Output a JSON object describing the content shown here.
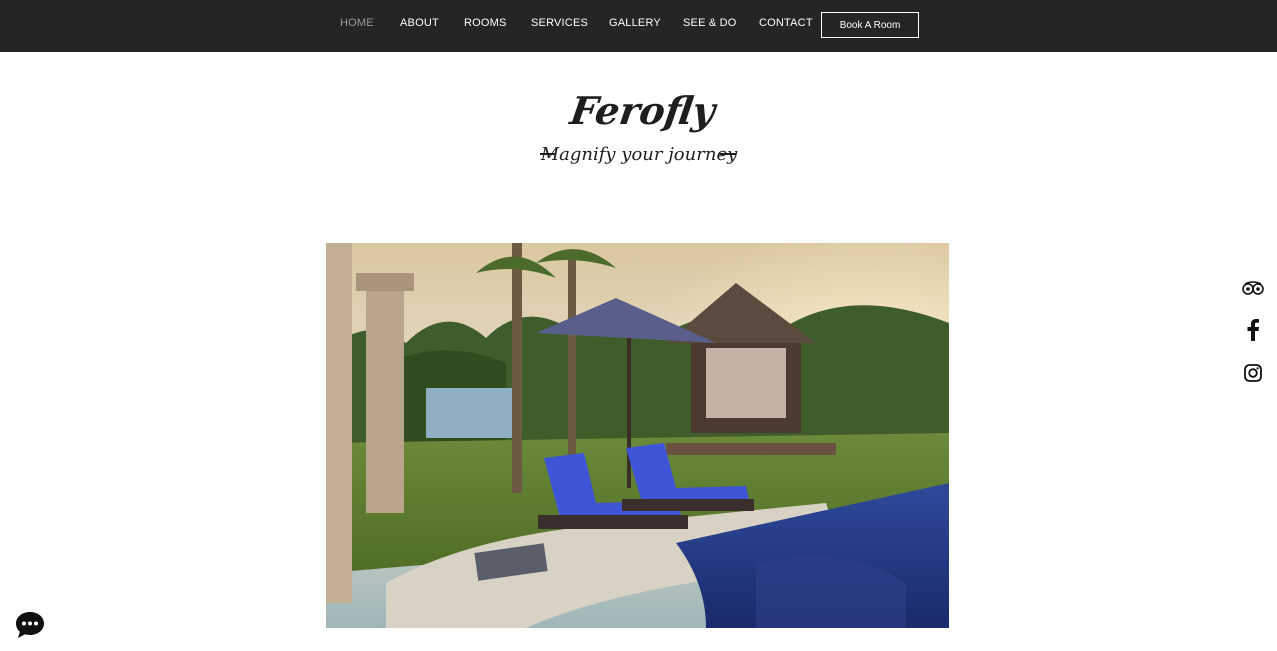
{
  "nav": {
    "items": [
      {
        "label": "HOME",
        "active": true
      },
      {
        "label": "ABOUT"
      },
      {
        "label": "ROOMS"
      },
      {
        "label": "SERVICES"
      },
      {
        "label": "GALLERY"
      },
      {
        "label": "SEE & DO"
      },
      {
        "label": "CONTACT"
      }
    ],
    "book_label": "Book A Room"
  },
  "brand": {
    "name": "Ferofly",
    "tagline": "Magnify your journey"
  },
  "hero": {
    "image": "resort-pool-with-loungers-and-gazebo"
  },
  "social": {
    "icons": [
      "tripadvisor-icon",
      "facebook-icon",
      "instagram-icon"
    ]
  },
  "chat": {
    "icon": "chat-bubble-icon"
  },
  "colors": {
    "topbar": "#252525",
    "nav_text": "#ffffff",
    "nav_active": "#9a9a9a"
  }
}
